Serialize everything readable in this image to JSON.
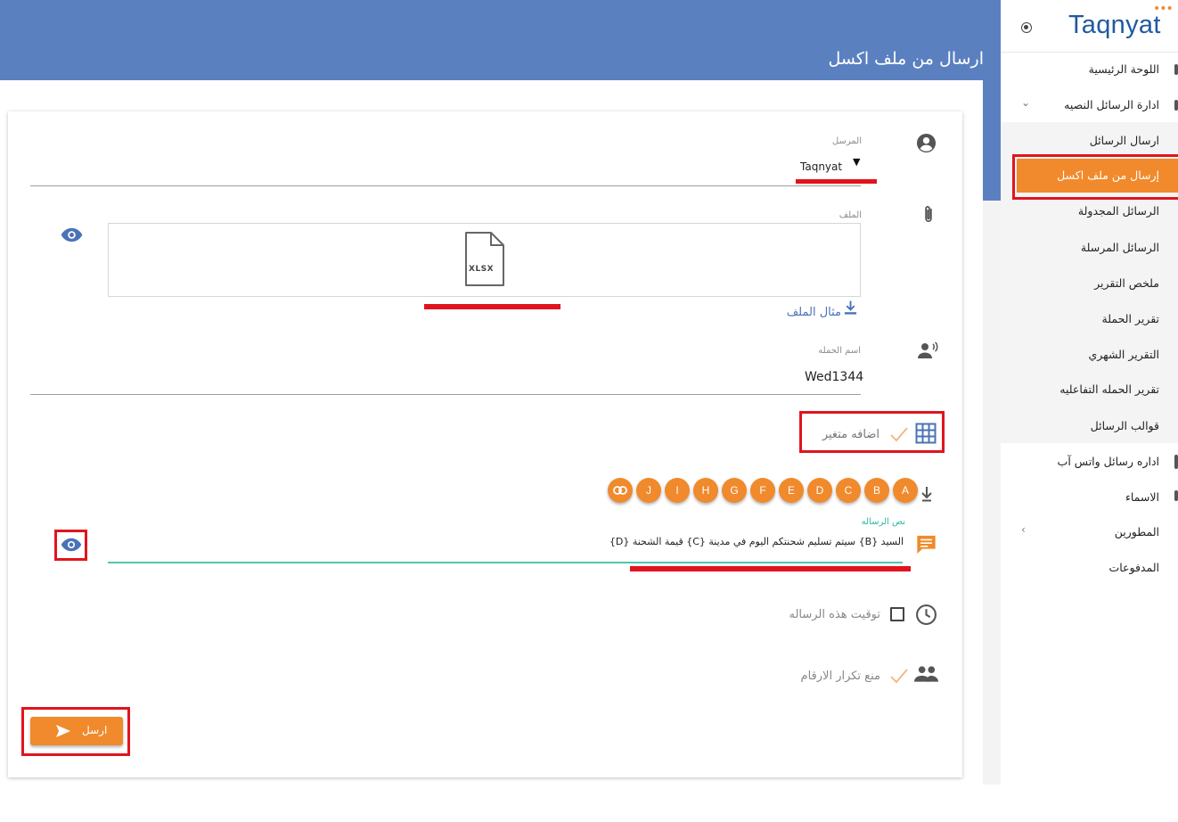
{
  "page": {
    "title": "ارسال من ملف اكسل"
  },
  "form": {
    "sender": {
      "label": "المرسل",
      "value": "Taqnyat"
    },
    "file": {
      "label": "الملف",
      "file_type": "XLSX",
      "example_link": "مثال الملف"
    },
    "campaign": {
      "label": "اسم الحمله",
      "value": "Wed1344"
    },
    "add_variable": {
      "label": "اضافه متغير"
    },
    "variables": [
      "A",
      "B",
      "C",
      "D",
      "E",
      "F",
      "G",
      "H",
      "I",
      "J"
    ],
    "message": {
      "label": "نص الرساله",
      "value": "السيد {B} سيتم تسليم شحنتكم اليوم في مدينة {C} قيمة الشحنة {D}"
    },
    "schedule": {
      "label": "توقيت هذه الرساله"
    },
    "prevent_duplicates": {
      "label": "منع تكرار الارقام"
    },
    "send_button": {
      "label": "ارسل"
    }
  },
  "sidebar": {
    "logo": "Taqnyat",
    "items": [
      {
        "label": "اللوحة الرئيسية"
      },
      {
        "label": "ادارة الرسائل النصيه"
      },
      {
        "label": "ارسال الرسائل"
      },
      {
        "label": "إرسال من ملف اكسل",
        "active": true
      },
      {
        "label": "الرسائل المجدولة"
      },
      {
        "label": "الرسائل المرسلة"
      },
      {
        "label": "ملخص التقرير"
      },
      {
        "label": "تقرير الحملة"
      },
      {
        "label": "التقرير الشهري"
      },
      {
        "label": "تقرير الحمله التفاعليه"
      },
      {
        "label": "قوالب الرسائل"
      },
      {
        "label": "اداره رسائل واتس آب"
      },
      {
        "label": "الاسماء"
      },
      {
        "label": "المطورين"
      },
      {
        "label": "المدفوعات"
      }
    ]
  },
  "colors": {
    "accent": "#f08a2c",
    "header": "#5a80c0",
    "brand": "#1f5aa0",
    "highlight": "#e1141e",
    "focus": "#4fc7b0"
  }
}
